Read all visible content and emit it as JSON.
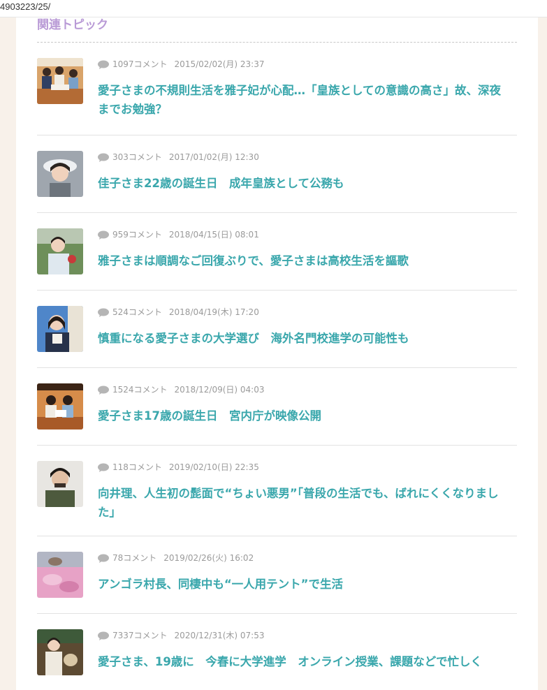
{
  "url": "4903223/25/",
  "section_title": "関連トピック",
  "colors": {
    "title": "#b99ad6",
    "link": "#3aa7ac",
    "meta": "#9a9a9a"
  },
  "topics": [
    {
      "comments": "1097コメント",
      "date": "2015/02/02(月) 23:37",
      "title": "愛子さまの不規則生活を雅子妃が心配…「皇族としての意識の高さ」故、深夜までお勉強？",
      "thumb": "family-photo"
    },
    {
      "comments": "303コメント",
      "date": "2017/01/02(月) 12:30",
      "title": "佳子さま22歳の誕生日　成年皇族として公務も",
      "thumb": "portrait-woman-hat"
    },
    {
      "comments": "959コメント",
      "date": "2018/04/15(日) 08:01",
      "title": "雅子さまは順調なご回復ぶりで、愛子さまは高校生活を謳歌",
      "thumb": "portrait-woman-outdoor"
    },
    {
      "comments": "524コメント",
      "date": "2018/04/19(木) 17:20",
      "title": "慎重になる愛子さまの大学選び　海外名門校進学の可能性も",
      "thumb": "portrait-woman-blue"
    },
    {
      "comments": "1524コメント",
      "date": "2018/12/09(日) 04:03",
      "title": "愛子さま17歳の誕生日　宮内庁が映像公開",
      "thumb": "family-photo"
    },
    {
      "comments": "118コメント",
      "date": "2019/02/10(日) 22:35",
      "title": "向井理、人生初の髭面で“ちょい悪男”「普段の生活でも、ばれにくくなりました」",
      "thumb": "portrait-man"
    },
    {
      "comments": "78コメント",
      "date": "2019/02/26(火) 16:02",
      "title": "アンゴラ村長、同棲中も“一人用テント”で生活",
      "thumb": "pink-blanket"
    },
    {
      "comments": "7337コメント",
      "date": "2020/12/31(木) 07:53",
      "title": "愛子さま、19歳に　今春に大学進学　オンライン授業、課題などで忙しく",
      "thumb": "portrait-woman-dog"
    }
  ]
}
